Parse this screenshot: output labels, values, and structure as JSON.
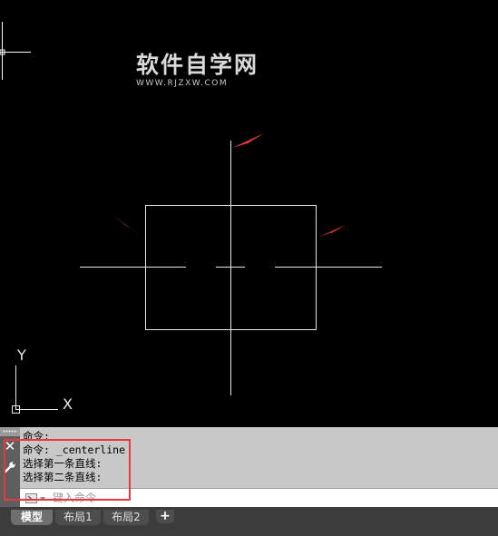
{
  "watermark": {
    "title": "软件自学网",
    "url": "WWW.RJZXW.COM"
  },
  "ucs": {
    "x_label": "X",
    "y_label": "Y"
  },
  "command": {
    "history": [
      "命令:",
      "命令: _centerline",
      "选择第一条直线:",
      "选择第二条直线:"
    ],
    "input_value": "",
    "input_placeholder": "键入命令"
  },
  "icons": {
    "close": "close-icon",
    "settings": "wrench-icon",
    "prompt": "command-prompt-icon",
    "add": "plus-icon"
  },
  "tabs": [
    {
      "label": "模型",
      "active": true
    },
    {
      "label": "布局1",
      "active": false
    },
    {
      "label": "布局2",
      "active": false
    }
  ],
  "add_tab_label": "+",
  "colors": {
    "background": "#000000",
    "geometry": "#e6e6e6",
    "arrow": "#e8383b",
    "highlight": "#e8383b",
    "command_panel": "#c8c8c8"
  }
}
